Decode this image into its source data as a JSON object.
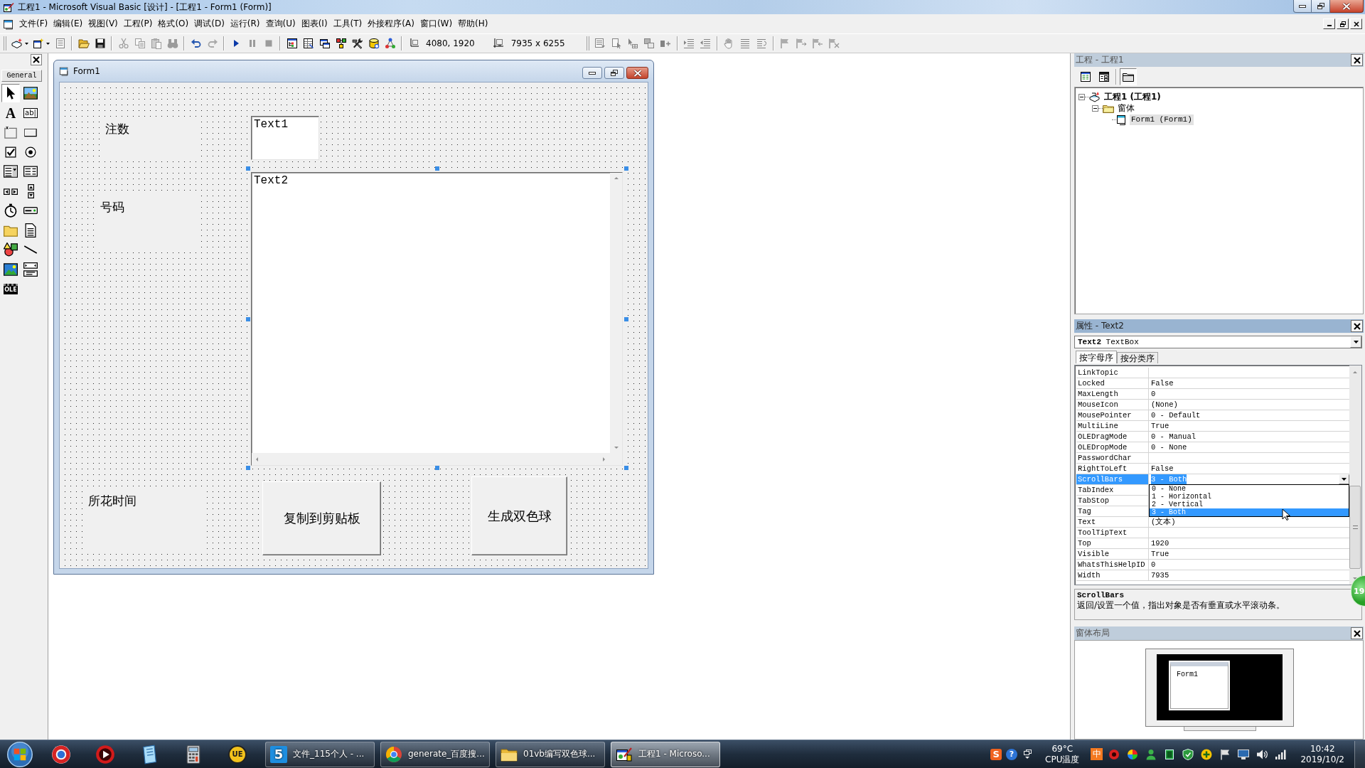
{
  "window": {
    "title": "工程1 - Microsoft Visual Basic [设计] - [工程1 - Form1 (Form)]"
  },
  "menu_bar": {
    "items": [
      "文件(F)",
      "编辑(E)",
      "视图(V)",
      "工程(P)",
      "格式(O)",
      "调试(D)",
      "运行(R)",
      "查询(U)",
      "图表(I)",
      "工具(T)",
      "外接程序(A)",
      "窗口(W)",
      "帮助(H)"
    ]
  },
  "toolbar": {
    "buttons": [
      {
        "disabled": false
      },
      {
        "disabled": false
      },
      {
        "disabled": true
      },
      {
        "disabled": false
      },
      {
        "disabled": false
      },
      {
        "disabled": true
      },
      {
        "disabled": true
      },
      {
        "disabled": true
      },
      {
        "disabled": true
      },
      {
        "disabled": false
      },
      {
        "disabled": true
      },
      {
        "disabled": false
      },
      {
        "disabled": true
      },
      {
        "disabled": true
      },
      {
        "disabled": false
      },
      {
        "disabled": false
      },
      {
        "disabled": false
      },
      {
        "disabled": false
      },
      {
        "disabled": false
      },
      {
        "disabled": false
      },
      {
        "disabled": false
      }
    ],
    "position": "4080, 1920",
    "size": "7935 x 6255"
  },
  "edit_toolbar": {
    "buttons": [
      {
        "disabled": true
      },
      {
        "disabled": true
      },
      {
        "disabled": true
      },
      {
        "disabled": true
      },
      {
        "disabled": true
      },
      {
        "disabled": true
      },
      {
        "disabled": true
      },
      {
        "disabled": true
      },
      {
        "disabled": true
      },
      {
        "disabled": true
      },
      {
        "disabled": true
      },
      {
        "disabled": true
      },
      {
        "disabled": true
      },
      {
        "disabled": true
      }
    ]
  },
  "toolbox": {
    "tab": "General",
    "tools": [
      {
        "selected": true
      },
      {
        "selected": false
      },
      {
        "selected": false,
        "glyph": "A"
      },
      {
        "selected": false,
        "glyph": "ab|"
      },
      {
        "selected": false
      },
      {
        "selected": false
      },
      {
        "selected": false
      },
      {
        "selected": false
      },
      {
        "selected": false
      },
      {
        "selected": false
      },
      {
        "selected": false
      },
      {
        "selected": false
      },
      {
        "selected": false
      },
      {
        "selected": false
      },
      {
        "selected": false
      },
      {
        "selected": false
      },
      {
        "selected": false
      },
      {
        "selected": false
      },
      {
        "selected": false
      },
      {
        "selected": false
      },
      {
        "selected": false,
        "glyph": "OLE"
      }
    ]
  },
  "form_designer": {
    "title": "Form1",
    "labels": [
      "注数",
      "号码",
      "所花时间"
    ],
    "textboxes": [
      {
        "text": "Text1",
        "selected": false
      },
      {
        "text": "Text2",
        "selected": true
      }
    ],
    "buttons": [
      "复制到剪贴板",
      "生成双色球"
    ]
  },
  "project_explorer": {
    "title": "工程 - 工程1",
    "toolbar": [
      {
        "selected": false
      },
      {
        "selected": false
      },
      {
        "selected": true
      }
    ],
    "tree": [
      {
        "label": "工程1 (工程1)",
        "expanded": true,
        "selected": false,
        "children": [
          {
            "label": "窗体",
            "expanded": true,
            "selected": false,
            "children": [
              {
                "label": "Form1 (Form1)",
                "selected": true
              }
            ]
          }
        ]
      }
    ]
  },
  "properties": {
    "title": "属性 - Text2",
    "object": "**Text2** TextBox",
    "tabs": [
      {
        "label": "按字母序",
        "selected": true
      },
      {
        "label": "按分类序",
        "selected": false
      }
    ],
    "rows": [
      {
        "name": "LinkTopic",
        "selected": false
      },
      {
        "name": "Locked",
        "value": "False",
        "selected": false
      },
      {
        "name": "MaxLength",
        "value": "0",
        "selected": false
      },
      {
        "name": "MouseIcon",
        "value": "(None)",
        "selected": false
      },
      {
        "name": "MousePointer",
        "value": "0 - Default",
        "selected": false
      },
      {
        "name": "MultiLine",
        "value": "True",
        "selected": false
      },
      {
        "name": "OLEDragMode",
        "value": "0 - Manual",
        "selected": false
      },
      {
        "name": "OLEDropMode",
        "value": "0 - None",
        "selected": false
      },
      {
        "name": "PasswordChar",
        "selected": false
      },
      {
        "name": "RightToLeft",
        "value": "False",
        "selected": false
      },
      {
        "name": "ScrollBars",
        "value": "3 - Both",
        "selected": true,
        "options": [
          {
            "label": "0 - None",
            "selected": false
          },
          {
            "label": "1 - Horizontal",
            "selected": false
          },
          {
            "label": "2 - Vertical",
            "selected": false
          },
          {
            "label": "3 - Both",
            "selected": true
          }
        ]
      },
      {
        "name": "TabIndex",
        "selected": false
      },
      {
        "name": "TabStop",
        "selected": false
      },
      {
        "name": "Tag",
        "selected": false
      },
      {
        "name": "Text",
        "value": "(文本)",
        "selected": false
      },
      {
        "name": "ToolTipText",
        "selected": false
      },
      {
        "name": "Top",
        "value": "1920",
        "selected": false
      },
      {
        "name": "Visible",
        "value": "True",
        "selected": false
      },
      {
        "name": "WhatsThisHelpID",
        "value": "0",
        "selected": false
      },
      {
        "name": "Width",
        "value": "7935",
        "selected": false
      }
    ],
    "description": {
      "name": "ScrollBars",
      "text": "返回/设置一个值，指出对象是否有垂直或水平滚动条。"
    }
  },
  "form_layout": {
    "title": "窗体布局",
    "form": "Form1"
  },
  "floating_ball": {
    "text": "19"
  },
  "taskbar": {
    "launcher_glyph": "UE",
    "tasks": [
      {
        "label": "文件_115个人 - ...",
        "glyph": "5",
        "selected": false
      },
      {
        "label": "generate_百度搜...",
        "selected": false
      },
      {
        "label": "01vb编写双色球...",
        "selected": false
      },
      {
        "label": "工程1 - Microso...",
        "selected": true
      }
    ],
    "tray": {
      "glyphs": [
        "S",
        "?"
      ],
      "temperature": "69°C",
      "temperature_label": "CPU温度",
      "input_mode": "中",
      "time": "10:42",
      "date": "2019/10/2"
    }
  }
}
